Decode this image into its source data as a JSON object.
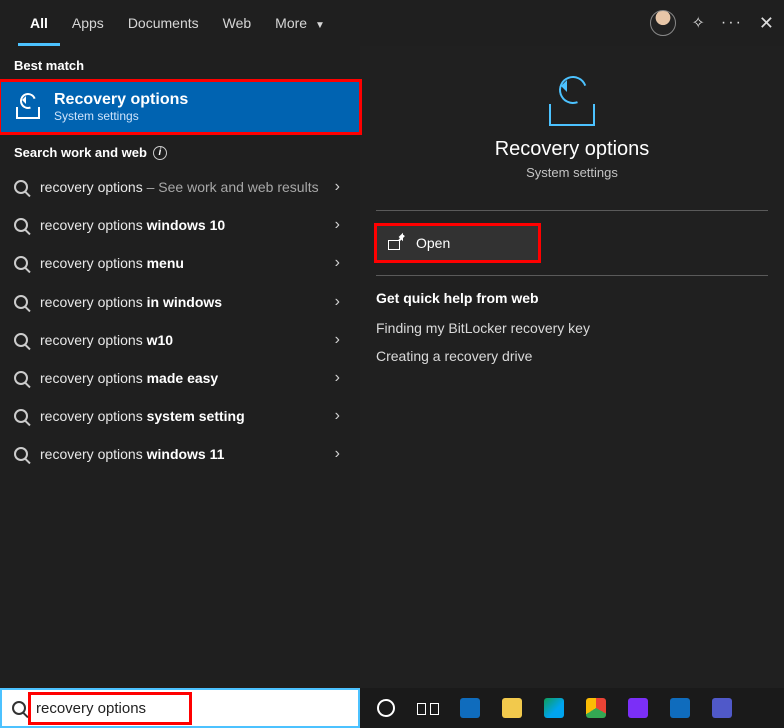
{
  "tabs": {
    "all": "All",
    "apps": "Apps",
    "documents": "Documents",
    "web": "Web",
    "more": "More"
  },
  "sections": {
    "best_match": "Best match",
    "search_web": "Search work and web"
  },
  "best": {
    "title": "Recovery options",
    "subtitle": "System settings"
  },
  "suggestions": [
    {
      "prefix": "recovery options",
      "bold": "",
      "suffix": " – See work and web results",
      "muted_suffix": true
    },
    {
      "prefix": "recovery options ",
      "bold": "windows 10",
      "suffix": ""
    },
    {
      "prefix": "recovery options ",
      "bold": "menu",
      "suffix": ""
    },
    {
      "prefix": "recovery options ",
      "bold": "in windows",
      "suffix": ""
    },
    {
      "prefix": "recovery options ",
      "bold": "w10",
      "suffix": ""
    },
    {
      "prefix": "recovery options ",
      "bold": "made easy",
      "suffix": ""
    },
    {
      "prefix": "recovery options ",
      "bold": "system setting",
      "suffix": ""
    },
    {
      "prefix": "recovery options ",
      "bold": "windows 11",
      "suffix": ""
    }
  ],
  "preview": {
    "title": "Recovery options",
    "subtitle": "System settings",
    "open_label": "Open",
    "help_header": "Get quick help from web",
    "help_links": [
      "Finding my BitLocker recovery key",
      "Creating a recovery drive"
    ]
  },
  "search_value": "recovery options",
  "taskbar_icons": [
    {
      "name": "cortana-icon",
      "bg": "transparent"
    },
    {
      "name": "task-view-icon",
      "bg": "transparent"
    },
    {
      "name": "mail-icon",
      "bg": "#0f6cbd"
    },
    {
      "name": "file-explorer-icon",
      "bg": "#f2c94c"
    },
    {
      "name": "edge-icon",
      "bg": "linear-gradient(135deg,#0f9d58 0%,#00a4ef 60%)"
    },
    {
      "name": "chrome-icon",
      "bg": "conic-gradient(#ea4335 0 33%,#34a853 33% 66%,#fbbc05 66% 100%)"
    },
    {
      "name": "paint-icon",
      "bg": "#7b2ff7"
    },
    {
      "name": "outlook-icon",
      "bg": "#0f6cbd"
    },
    {
      "name": "teams-icon",
      "bg": "#5059c9"
    }
  ]
}
